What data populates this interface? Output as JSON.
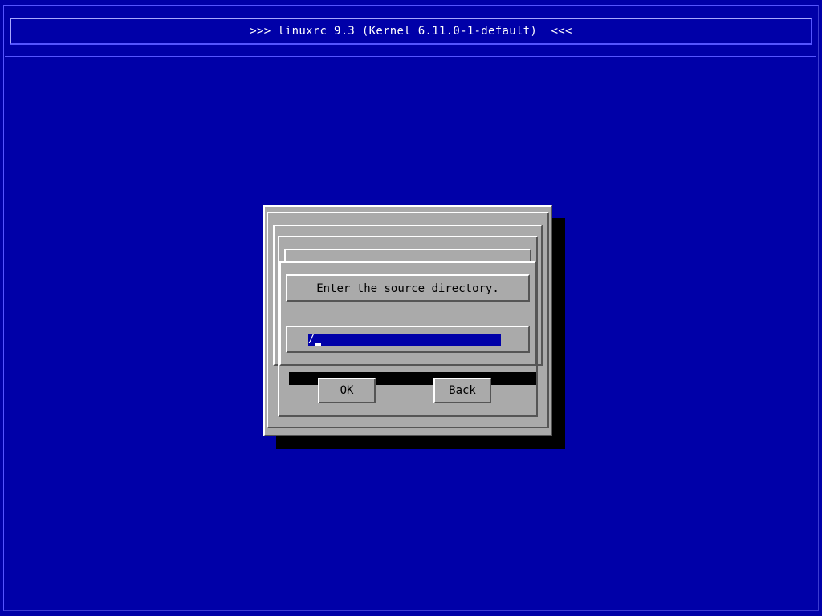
{
  "header": {
    "title": ">>> linuxrc 9.3 (Kernel 6.11.0-1-default)  <<<"
  },
  "dialog": {
    "prompt": "Enter the source directory.",
    "input_value": "/",
    "buttons": {
      "ok_label": "OK",
      "back_label": "Back"
    }
  },
  "colors": {
    "background": "#0000a8",
    "dialog": "#aaaaaa",
    "input_background": "#0000a8",
    "shadow": "#000000",
    "text_light": "#ffffff",
    "text_dark": "#000000"
  }
}
